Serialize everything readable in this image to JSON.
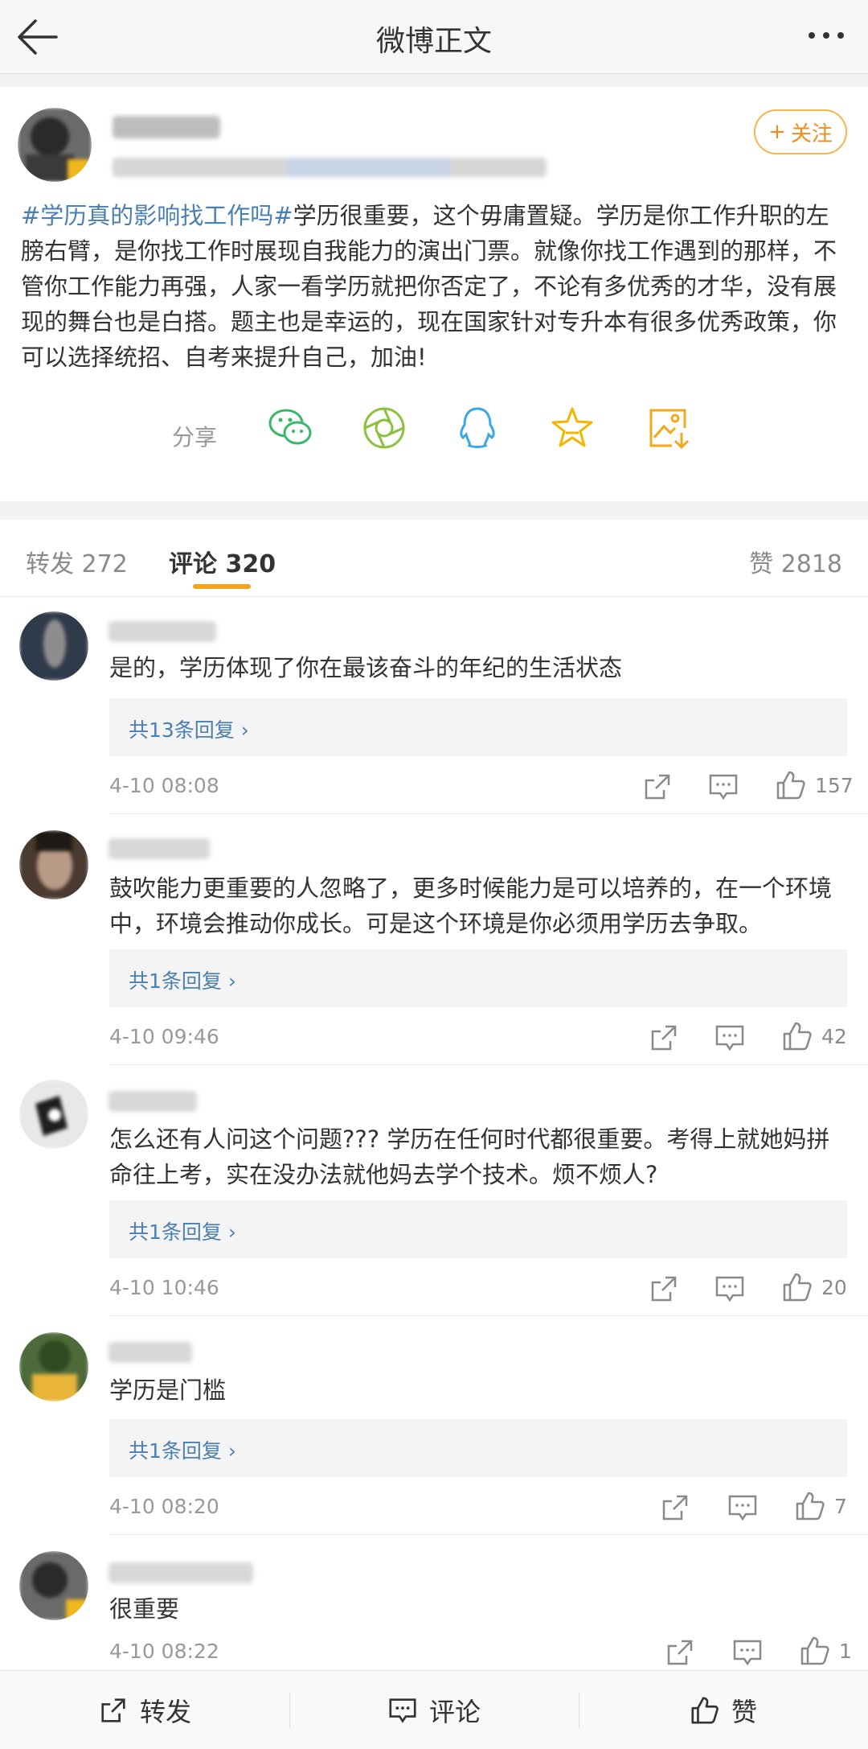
{
  "header": {
    "title": "微博正文",
    "back_icon": "arrow-left-icon",
    "more_icon": "more-dots-icon"
  },
  "post": {
    "follow_label": "关注",
    "hashtag": "#学历真的影响找工作吗#",
    "body": "学历很重要，这个毋庸置疑。学历是你工作升职的左膀右臂，是你找工作时展现自我能力的演出门票。就像你找工作遇到的那样，不管你工作能力再强，人家一看学历就把你否定了，不论有多优秀的才华，没有展现的舞台也是白搭。题主也是幸运的，现在国家针对专升本有很多优秀政策，你可以选择统招、自考来提升自己，加油!",
    "share_label": "分享",
    "share_icons": [
      "wechat-icon",
      "moments-icon",
      "qq-icon",
      "favorite-star-icon",
      "save-image-icon"
    ]
  },
  "tabs": {
    "repost": "转发 272",
    "comments_label": "评论",
    "comments_count": "320",
    "likes": "赞 2818"
  },
  "comments": [
    {
      "text": "是的，学历体现了你在最该奋斗的年纪的生活状态",
      "replies": "共13条回复 ›",
      "time": "4-10 08:08",
      "likes": "157"
    },
    {
      "text": "鼓吹能力更重要的人忽略了，更多时候能力是可以培养的，在一个环境中，环境会推动你成长。可是这个环境是你必须用学历去争取。",
      "replies": "共1条回复 ›",
      "time": "4-10 09:46",
      "likes": "42"
    },
    {
      "text": "怎么还有人问这个问题??? 学历在任何时代都很重要。考得上就她妈拼命往上考，实在没办法就他妈去学个技术。烦不烦人?",
      "replies": "共1条回复 ›",
      "time": "4-10 10:46",
      "likes": "20"
    },
    {
      "text": "学历是门槛",
      "replies": "共1条回复 ›",
      "time": "4-10 08:20",
      "likes": "7"
    },
    {
      "text": "很重要",
      "replies": "",
      "time": "4-10 08:22",
      "likes": "1"
    }
  ],
  "bottombar": {
    "repost": "转发",
    "comment": "评论",
    "like": "赞"
  },
  "colors": {
    "accent": "#f7a21a",
    "link": "#4a7fb3",
    "follow": "#f28b17"
  }
}
